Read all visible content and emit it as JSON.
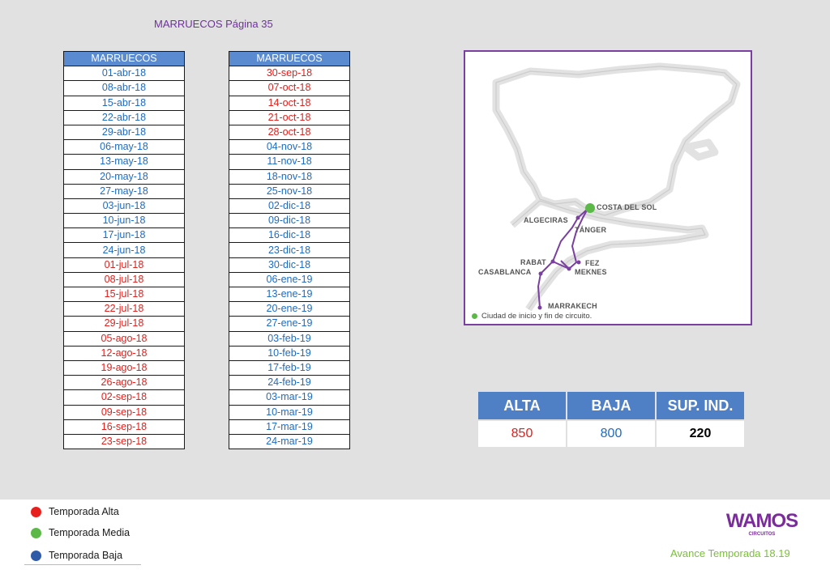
{
  "header": {
    "title": "MARRUECOS Página 35"
  },
  "table_left": {
    "header": "MARRUECOS",
    "rows": [
      {
        "date": "01-abr-18",
        "season": "baja"
      },
      {
        "date": "08-abr-18",
        "season": "baja"
      },
      {
        "date": "15-abr-18",
        "season": "baja"
      },
      {
        "date": "22-abr-18",
        "season": "baja"
      },
      {
        "date": "29-abr-18",
        "season": "baja"
      },
      {
        "date": "06-may-18",
        "season": "baja"
      },
      {
        "date": "13-may-18",
        "season": "baja"
      },
      {
        "date": "20-may-18",
        "season": "baja"
      },
      {
        "date": "27-may-18",
        "season": "baja"
      },
      {
        "date": "03-jun-18",
        "season": "baja"
      },
      {
        "date": "10-jun-18",
        "season": "baja"
      },
      {
        "date": "17-jun-18",
        "season": "baja"
      },
      {
        "date": "24-jun-18",
        "season": "baja"
      },
      {
        "date": "01-jul-18",
        "season": "alta"
      },
      {
        "date": "08-jul-18",
        "season": "alta"
      },
      {
        "date": "15-jul-18",
        "season": "alta"
      },
      {
        "date": "22-jul-18",
        "season": "alta"
      },
      {
        "date": "29-jul-18",
        "season": "alta"
      },
      {
        "date": "05-ago-18",
        "season": "alta"
      },
      {
        "date": "12-ago-18",
        "season": "alta"
      },
      {
        "date": "19-ago-18",
        "season": "alta"
      },
      {
        "date": "26-ago-18",
        "season": "alta"
      },
      {
        "date": "02-sep-18",
        "season": "alta"
      },
      {
        "date": "09-sep-18",
        "season": "alta"
      },
      {
        "date": "16-sep-18",
        "season": "alta"
      },
      {
        "date": "23-sep-18",
        "season": "alta"
      }
    ]
  },
  "table_right": {
    "header": "MARRUECOS",
    "rows": [
      {
        "date": "30-sep-18",
        "season": "alta"
      },
      {
        "date": "07-oct-18",
        "season": "alta"
      },
      {
        "date": "14-oct-18",
        "season": "alta"
      },
      {
        "date": "21-oct-18",
        "season": "alta"
      },
      {
        "date": "28-oct-18",
        "season": "alta"
      },
      {
        "date": "04-nov-18",
        "season": "baja"
      },
      {
        "date": "11-nov-18",
        "season": "baja"
      },
      {
        "date": "18-nov-18",
        "season": "baja"
      },
      {
        "date": "25-nov-18",
        "season": "baja"
      },
      {
        "date": "02-dic-18",
        "season": "baja"
      },
      {
        "date": "09-dic-18",
        "season": "baja"
      },
      {
        "date": "16-dic-18",
        "season": "baja"
      },
      {
        "date": "23-dic-18",
        "season": "baja"
      },
      {
        "date": "30-dic-18",
        "season": "baja"
      },
      {
        "date": "06-ene-19",
        "season": "baja"
      },
      {
        "date": "13-ene-19",
        "season": "baja"
      },
      {
        "date": "20-ene-19",
        "season": "baja"
      },
      {
        "date": "27-ene-19",
        "season": "baja"
      },
      {
        "date": "03-feb-19",
        "season": "baja"
      },
      {
        "date": "10-feb-19",
        "season": "baja"
      },
      {
        "date": "17-feb-19",
        "season": "baja"
      },
      {
        "date": "24-feb-19",
        "season": "baja"
      },
      {
        "date": "03-mar-19",
        "season": "baja"
      },
      {
        "date": "10-mar-19",
        "season": "baja"
      },
      {
        "date": "17-mar-19",
        "season": "baja"
      },
      {
        "date": "24-mar-19",
        "season": "baja"
      }
    ]
  },
  "map": {
    "cities": {
      "costa_del_sol": "COSTA DEL SOL",
      "algeciras": "ALGECIRAS",
      "tanger": "TÁNGER",
      "rabat": "RABAT",
      "casablanca": "CASABLANCA",
      "fez": "FEZ",
      "meknes": "MEKNES",
      "marrakech": "MARRAKECH"
    },
    "legend": "Ciudad de inicio y fin de circuito.",
    "route_color": "#7a3fa0",
    "start_color": "#5cb947"
  },
  "prices": {
    "headers": [
      "ALTA",
      "BAJA",
      "SUP. IND."
    ],
    "alta": "850",
    "baja": "800",
    "sup_ind": "220"
  },
  "season_legend": [
    {
      "label": "Temporada Alta",
      "color": "#e8201c"
    },
    {
      "label": "Temporada Media",
      "color": "#5cb947"
    },
    {
      "label": "Temporada Baja",
      "color": "#2e5aa8"
    }
  ],
  "footer": {
    "logo_text": "WAMOS",
    "logo_sub": "CIRCUITOS",
    "season": "Avance Temporada 18.19"
  },
  "colors": {
    "alta": "#e0201c",
    "baja": "#1e6bc2",
    "header": "#5a8ad0",
    "accent": "#7030a0"
  }
}
